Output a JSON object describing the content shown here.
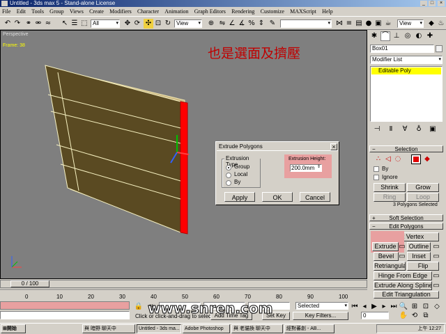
{
  "window": {
    "title": "Untitled - 3ds max 5 - Stand-alone License"
  },
  "menu": [
    "File",
    "Edit",
    "Tools",
    "Group",
    "Views",
    "Create",
    "Modifiers",
    "Character",
    "Animation",
    "Graph Editors",
    "Rendering",
    "Customize",
    "MAXScript",
    "Help"
  ],
  "toolbar": {
    "selection_filter": "All",
    "ref_coord": "View",
    "ref_coord2": "View"
  },
  "viewport": {
    "label": "Perspective",
    "frame": "Frame: 38",
    "overlay_text": "也是選面及擠壓"
  },
  "dialog": {
    "title": "Extrude Polygons",
    "group_label": "Extrusion Type",
    "options": [
      "Group",
      "Local",
      "By"
    ],
    "selected_option": "Group",
    "height_label": "Extrusion Height:",
    "height_value": "200.0mm",
    "apply": "Apply",
    "ok": "OK",
    "cancel": "Cancel"
  },
  "cmdpanel": {
    "object_name": "Box01",
    "modifier_list": "Modifier List",
    "stack_item": "Editable Poly",
    "selection_title": "Selection",
    "by_label": "By",
    "ignore_label": "Ignore",
    "shrink": "Shrink",
    "grow": "Grow",
    "ring": "Ring",
    "loop": "Loop",
    "selection_status": "3 Polygons Selected",
    "soft_selection": "Soft Selection",
    "edit_polygons": "Edit Polygons",
    "insert_vertex": "Insert Vertex",
    "extrude": "Extrude",
    "outline": "Outline",
    "bevel": "Bevel",
    "inset": "Inset",
    "retriangulate": "Retriangulate",
    "flip": "Flip",
    "hinge_from_edge": "Hinge From Edge",
    "extrude_along_spline": "Extrude Along Spline",
    "edit_triangulation": "Edit Triangulation"
  },
  "timeline": {
    "slider_label": "0 / 100",
    "ticks": [
      "0",
      "10",
      "20",
      "30",
      "40",
      "50",
      "60",
      "70",
      "80",
      "90",
      "100"
    ]
  },
  "status": {
    "prompt": "Click or click-and-drag to select objects",
    "add_time_tag": "Add Time Tag",
    "set_key": "Set Key",
    "key_filters": "Key Filters...",
    "selected": "Selected",
    "frame_field": "0",
    "watermark": "www.snren.com"
  },
  "taskbar": {
    "start": "開始",
    "items": [
      "與 暗野 聊天中",
      "Untitled - 3ds ma...",
      "Adobe Photoshop",
      "與 老貓換 聊天中",
      "經對蕃創 - AB..."
    ],
    "clock": "上午 12:27"
  },
  "colors": {
    "accent_red": "#ff0000",
    "stack_yellow": "#ffff00",
    "highlight_pink": "#e8a0a0",
    "plane_fill": "#5a4a22"
  }
}
